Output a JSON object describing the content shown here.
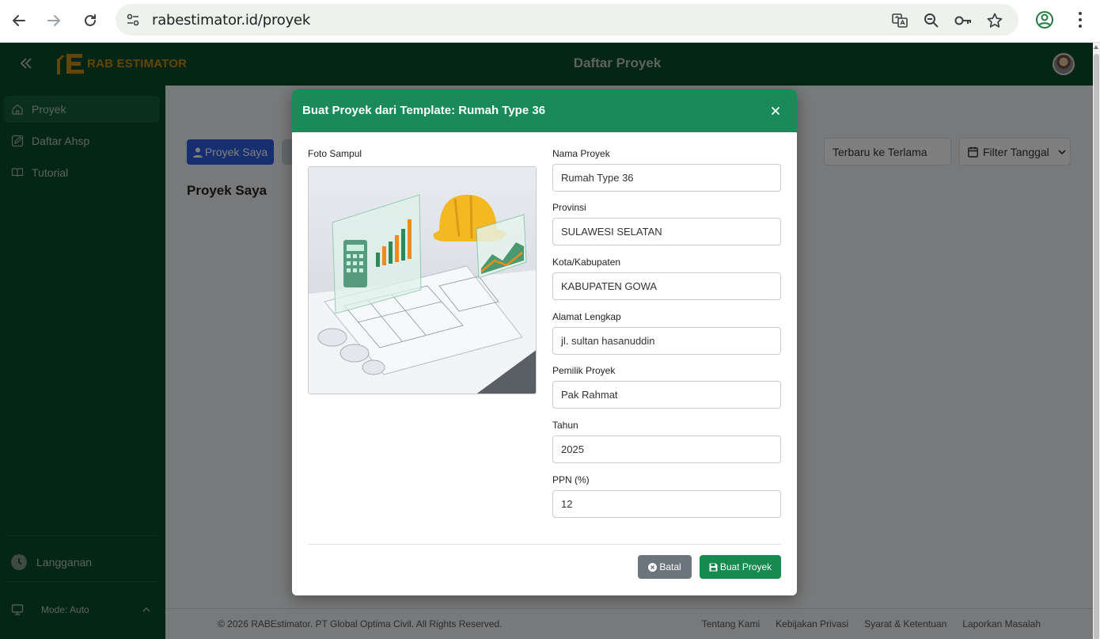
{
  "browser": {
    "url": "rabestimator.id/proyek"
  },
  "header": {
    "brand": "RAB ESTIMATOR",
    "title": "Daftar Proyek"
  },
  "sidebar": {
    "items": [
      {
        "label": "Proyek",
        "icon": "home-icon",
        "active": true
      },
      {
        "label": "Daftar Ahsp",
        "icon": "edit-note-icon",
        "active": false
      },
      {
        "label": "Tutorial",
        "icon": "book-icon",
        "active": false
      }
    ],
    "subscription": "Langganan",
    "mode": "Mode: Auto"
  },
  "main": {
    "my_projects_button": "Proyek Saya",
    "section_title": "Proyek Saya",
    "sort_value": "Terbaru ke Terlama",
    "date_filter": "Filter Tanggal"
  },
  "footer": {
    "copyright": "© 2026 RABEstimator. PT Global Optima Civil. All Rights Reserved.",
    "links": [
      "Tentang Kami",
      "Kebijakan Privasi",
      "Syarat & Ketentuan",
      "Laporkan Masalah"
    ]
  },
  "modal": {
    "title": "Buat Proyek dari Template: Rumah Type 36",
    "cover_label": "Foto Sampul",
    "fields": [
      {
        "label": "Nama Proyek",
        "value": "Rumah Type 36"
      },
      {
        "label": "Provinsi",
        "value": "SULAWESI SELATAN"
      },
      {
        "label": "Kota/Kabupaten",
        "value": "KABUPATEN GOWA"
      },
      {
        "label": "Alamat Lengkap",
        "value": "jl. sultan hasanuddin"
      },
      {
        "label": "Pemilik Proyek",
        "value": "Pak Rahmat"
      },
      {
        "label": "Tahun",
        "value": "2025"
      },
      {
        "label": "PPN (%)",
        "value": "12"
      }
    ],
    "cancel_label": "Batal",
    "submit_label": "Buat Proyek"
  },
  "colors": {
    "header_green": "#0b4a2b",
    "modal_header": "#1a8a58",
    "primary_blue": "#2f5dde",
    "submit_green": "#168a4f",
    "cancel_gray": "#6c757d",
    "brand_gold": "#c98a14"
  }
}
